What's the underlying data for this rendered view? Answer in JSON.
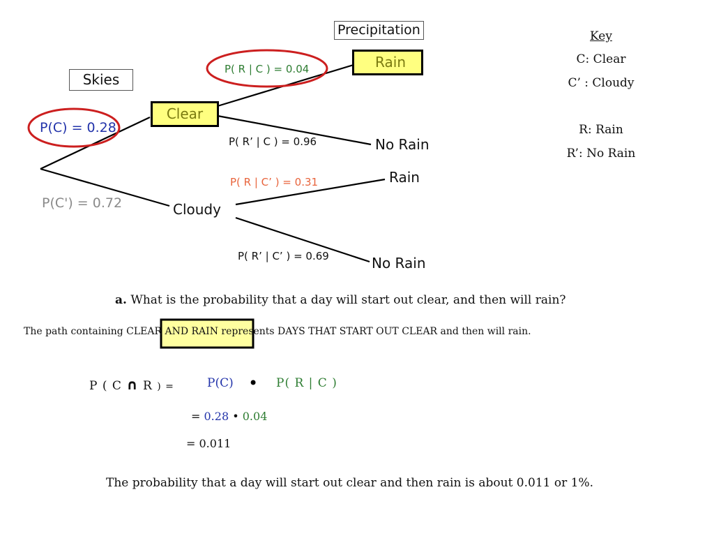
{
  "colors": {
    "highlight_fill": "#ffff80",
    "circle_red": "#cc1f1f",
    "blue": "#2233aa",
    "green": "#2e7d32",
    "orange": "#e8643c",
    "grey": "#8a8a8a",
    "olive": "#7a7a10"
  },
  "tree": {
    "headers": {
      "skies": "Skies",
      "precipitation": "Precipitation"
    },
    "nodes": {
      "clear": "Clear",
      "cloudy": "Cloudy",
      "clear_rain": "Rain",
      "clear_no_rain": "No Rain",
      "cloudy_rain": "Rain",
      "cloudy_no_rain": "No Rain"
    },
    "probabilities": {
      "p_clear": "P(C) = 0.28",
      "p_cloudy": "P(C') = 0.72",
      "p_rain_given_clear": "P( R | C ) = 0.04",
      "p_norain_given_clear": "P( R’ | C ) = 0.96",
      "p_rain_given_cloudy": "P( R | C’ ) = 0.31",
      "p_norain_given_cloudy": "P( R’ | C’ ) = 0.69"
    }
  },
  "key": {
    "title": "Key",
    "items": [
      "C: Clear",
      "C’ : Cloudy",
      "R: Rain",
      "R’: No Rain"
    ]
  },
  "question": {
    "label": "a.",
    "text": "What is the probability that a day will start out clear, and then will rain?"
  },
  "explanation": "The path containing CLEAR AND RAIN represents DAYS THAT START OUT CLEAR and then will rain.",
  "equation": {
    "lhs_p": "P",
    "lhs_open": "(",
    "lhs_c": "C",
    "lhs_cap": "∩",
    "lhs_r": "R",
    "lhs_close": ") =",
    "term1": "P(C)",
    "dot": "•",
    "term2": "P( R | C )",
    "line2_eq": "=",
    "line2_a": "0.28",
    "line2_dot": "•",
    "line2_b": "0.04",
    "line3": "= 0.011"
  },
  "conclusion": "The probability that a day will start out clear and then rain is about 0.011 or 1%."
}
